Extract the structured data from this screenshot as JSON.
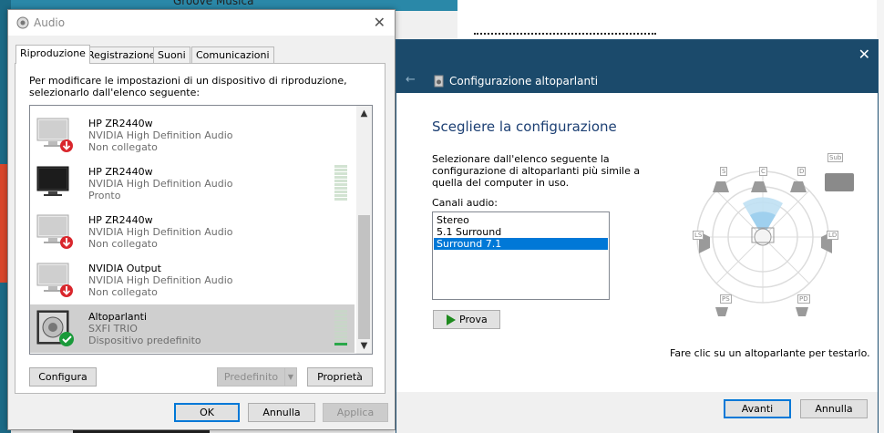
{
  "background": {
    "app_title": "Groove Musica"
  },
  "audio_dialog": {
    "title": "Audio",
    "tabs": [
      {
        "label": "Riproduzione",
        "active": true
      },
      {
        "label": "Registrazione",
        "active": false
      },
      {
        "label": "Suoni",
        "active": false
      },
      {
        "label": "Comunicazioni",
        "active": false
      }
    ],
    "instructions": "Per modificare le impostazioni di un dispositivo di riproduzione, selezionarlo dall'elenco seguente:",
    "devices": [
      {
        "name": "HP ZR2440w",
        "driver": "NVIDIA High Definition Audio",
        "status": "Non collegato",
        "icon": "monitor-icon",
        "badge": "red-down-arrow-icon",
        "disabled": true
      },
      {
        "name": "HP ZR2440w",
        "driver": "NVIDIA High Definition Audio",
        "status": "Pronto",
        "icon": "monitor-icon",
        "badge": "",
        "disabled": false
      },
      {
        "name": "HP ZR2440w",
        "driver": "NVIDIA High Definition Audio",
        "status": "Non collegato",
        "icon": "monitor-icon",
        "badge": "red-down-arrow-icon",
        "disabled": true
      },
      {
        "name": "NVIDIA Output",
        "driver": "NVIDIA High Definition Audio",
        "status": "Non collegato",
        "icon": "monitor-icon",
        "badge": "red-down-arrow-icon",
        "disabled": true
      },
      {
        "name": "Altoparlanti",
        "driver": "SXFI TRIO",
        "status": "Dispositivo predefinito",
        "icon": "speaker-icon",
        "badge": "green-check-icon",
        "disabled": false,
        "selected": true
      }
    ],
    "buttons": {
      "configure": "Configura",
      "default": "Predefinito",
      "properties": "Proprietà",
      "ok": "OK",
      "cancel": "Annulla",
      "apply": "Applica"
    }
  },
  "speaker_dialog": {
    "title": "Configurazione altoparlanti",
    "heading": "Scegliere la configurazione",
    "description": "Selezionare dall'elenco seguente la configurazione di altoparlanti più simile a quella del computer in uso.",
    "channels_label": "Canali audio:",
    "channels": [
      {
        "label": "Stereo",
        "selected": false
      },
      {
        "label": "5.1 Surround",
        "selected": false
      },
      {
        "label": "Surround 7.1",
        "selected": true
      }
    ],
    "test_button": "Prova",
    "hint": "Fare clic su un altoparlante per testarlo.",
    "speaker_labels": {
      "sl": "S",
      "c": "C",
      "r": "D",
      "sub": "Sub",
      "ls": "LS",
      "ld": "LD",
      "ps": "PS",
      "pd": "PD"
    },
    "buttons": {
      "next": "Avanti",
      "cancel": "Annulla"
    },
    "colors": {
      "header": "#1b4a6b",
      "accent": "#0078d7"
    }
  }
}
